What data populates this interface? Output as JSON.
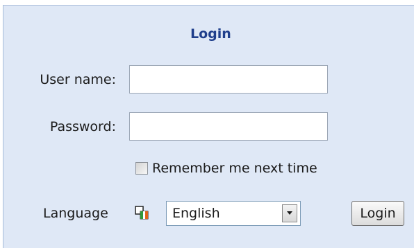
{
  "form": {
    "title": "Login",
    "username_label": "User name:",
    "username_value": "",
    "password_label": "Password:",
    "password_value": "",
    "remember_label": "Remember me next time",
    "remember_checked": false,
    "language_label": "Language",
    "language_icon": "language-flag-icon",
    "language_selected": "English",
    "submit_label": "Login"
  }
}
